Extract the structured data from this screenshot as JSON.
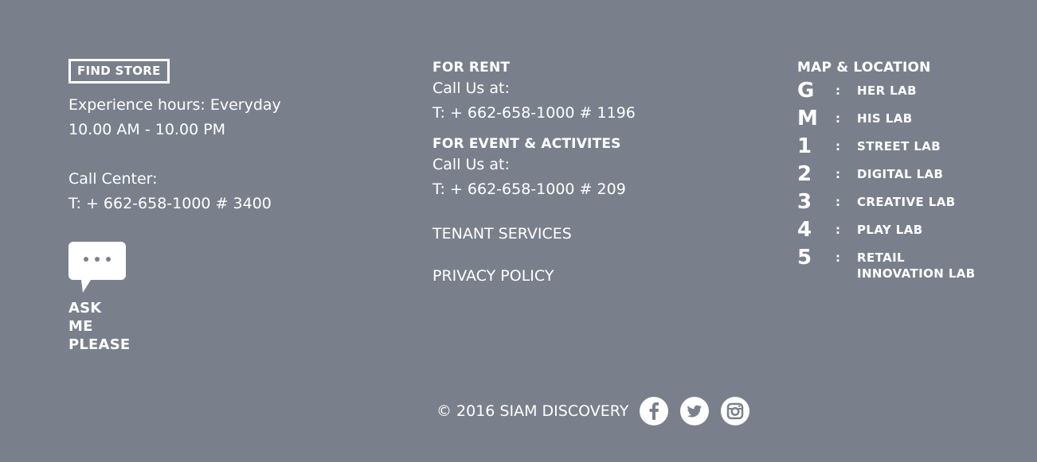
{
  "left": {
    "find_store": "FIND STORE",
    "hours_line1": "Experience hours: Everyday",
    "hours_line2": "10.00 AM - 10.00 PM",
    "call_center_label": "Call Center:",
    "call_center_phone": "T: + 662-658-1000 # 3400",
    "ask_me": [
      "ASK",
      "ME",
      "PLEASE"
    ]
  },
  "middle": {
    "rent_heading": "FOR RENT",
    "rent_call": "Call Us at:",
    "rent_phone": "T: + 662-658-1000 # 1196",
    "event_heading": "FOR EVENT & ACTIVITES",
    "event_call": "Call Us at:",
    "event_phone": "T: + 662-658-1000 # 209",
    "tenant_services": "TENANT SERVICES",
    "privacy_policy": "PRIVACY POLICY"
  },
  "map": {
    "title": "MAP & LOCATION",
    "floors": [
      {
        "num": "G",
        "name": "HER LAB"
      },
      {
        "num": "M",
        "name": "HIS LAB"
      },
      {
        "num": "1",
        "name": "STREET LAB"
      },
      {
        "num": "2",
        "name": "DIGITAL LAB"
      },
      {
        "num": "3",
        "name": "CREATIVE LAB"
      },
      {
        "num": "4",
        "name": "PLAY LAB"
      },
      {
        "num": "5",
        "name": "RETAIL INNOVATION LAB"
      }
    ],
    "separator": ":"
  },
  "footer": {
    "copyright": "© 2016 SIAM DISCOVERY",
    "social": [
      "facebook-icon",
      "twitter-icon",
      "instagram-icon"
    ]
  },
  "colors": {
    "background": "#7a808b",
    "text": "#ffffff"
  }
}
